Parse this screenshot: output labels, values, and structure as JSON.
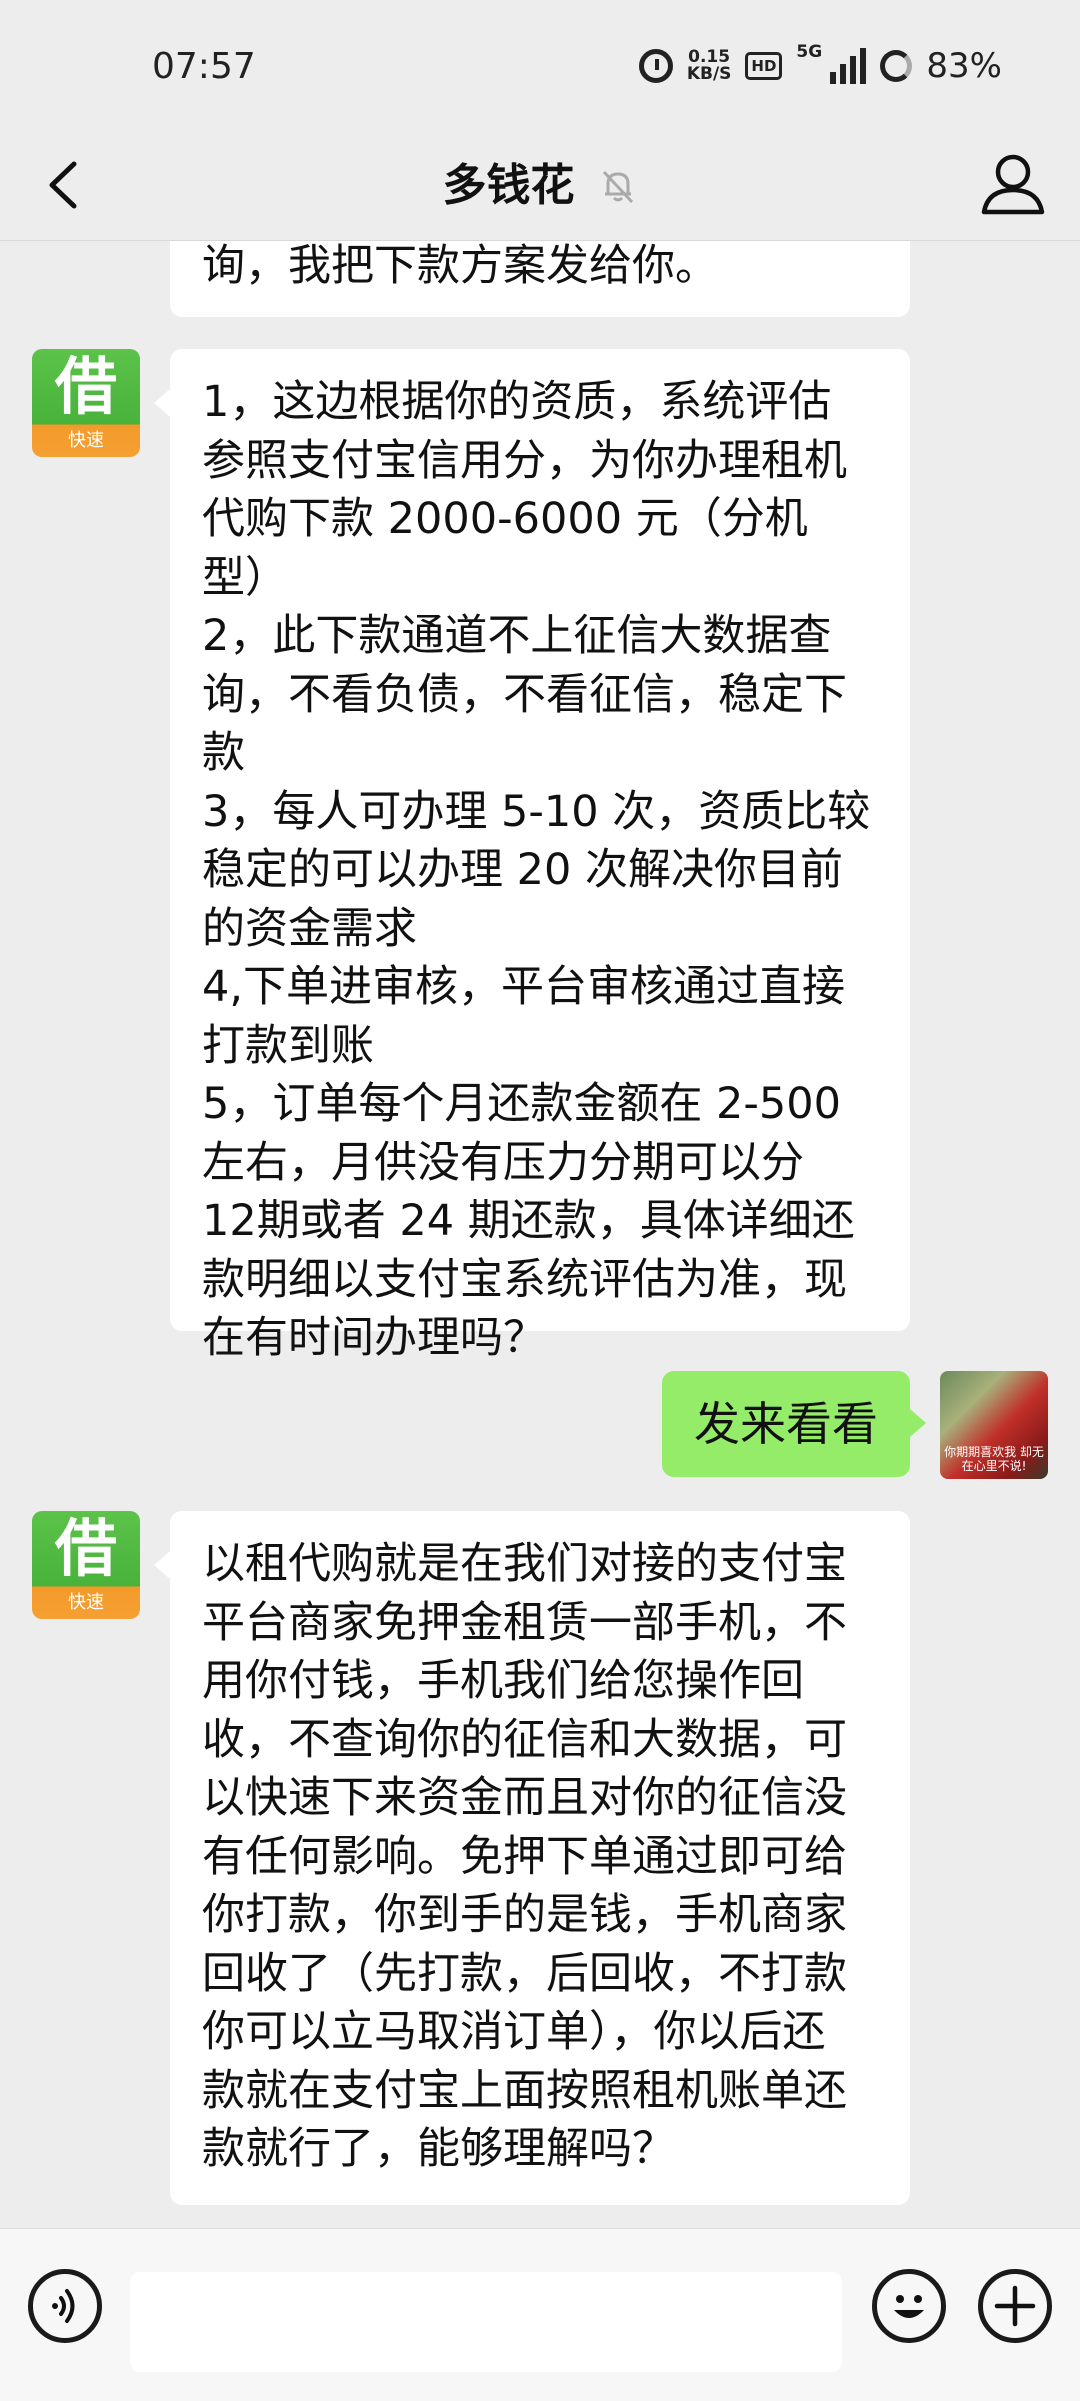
{
  "status_bar": {
    "time": "07:57",
    "net_speed_value": "0.15",
    "net_speed_unit": "KB/S",
    "hd": "HD",
    "network": "5G",
    "battery": "83%"
  },
  "header": {
    "title": "多钱花",
    "muted": true
  },
  "contact": {
    "avatar_char": "借",
    "avatar_sub": "快速",
    "avatar_colors": {
      "top": "#4cb63c",
      "bottom": "#f5a032"
    }
  },
  "me": {
    "avatar_caption": "你期期喜欢我\n却无在心里不说!"
  },
  "messages": [
    {
      "from": "contact",
      "text": "询，我把下款方案发给你。"
    },
    {
      "from": "contact",
      "text": "1，这边根据你的资质，系统评估\n参照支付宝信用分，为你办理租机\n代购下款 2000-6000 元（分机型）\n2，此下款通道不上征信大数据查\n询，不看负债，不看征信，稳定下\n款\n3，每人可办理 5-10 次，资质比较\n稳定的可以办理 20 次解决你目前\n的资金需求\n4,下单进审核，平台审核通过直接\n打款到账\n5，订单每个月还款金额在 2-500\n左右，月供没有压力分期可以分\n12期或者 24 期还款，具体详细还\n款明细以支付宝系统评估为准，现\n在有时间办理吗？"
    },
    {
      "from": "me",
      "text": "发来看看"
    },
    {
      "from": "contact",
      "text": "以租代购就是在我们对接的支付宝\n平台商家免押金租赁一部手机，不\n用你付钱，手机我们给您操作回\n收，不查询你的征信和大数据，可\n以快速下来资金而且对你的征信没\n有任何影响。免押下单通过即可给\n你打款，你到手的是钱，手机商家\n回收了（先打款，后回收，不打款\n你可以立马取消订单），你以后还\n款就在支付宝上面按照租机账单还\n款就行了，能够理解吗？"
    },
    {
      "from": "me",
      "text": ""
    }
  ],
  "input": {
    "value": ""
  },
  "colors": {
    "background": "#ededed",
    "bubble_contact": "#ffffff",
    "bubble_me": "#95ec69"
  },
  "icons": [
    "back-chevron-icon",
    "mute-bell-icon",
    "profile-icon",
    "voice-icon",
    "emoji-icon",
    "plus-icon",
    "alarm-icon",
    "signal-icon",
    "battery-icon"
  ]
}
